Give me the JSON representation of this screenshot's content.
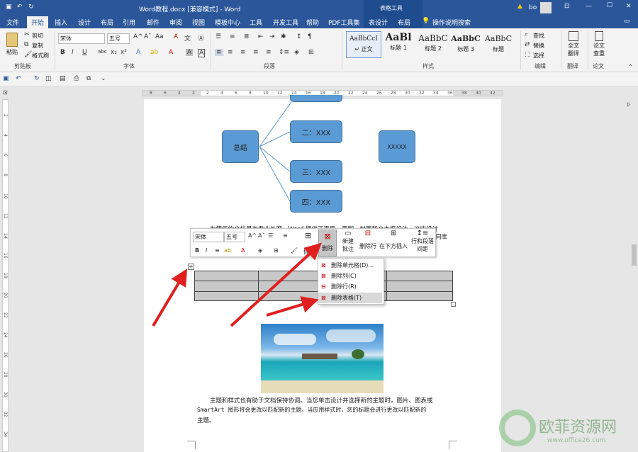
{
  "window": {
    "title": "Word教程.docx [兼容模式] - Word",
    "contextual_tools": "表格工具",
    "warning_icon": "warning-icon",
    "user": "bo",
    "accent_color": "#2b579a"
  },
  "tabs": [
    "文件",
    "开始",
    "插入",
    "设计",
    "布局",
    "引用",
    "邮件",
    "审阅",
    "视图",
    "模板中心",
    "工具",
    "开发工具",
    "帮助",
    "PDF工具集",
    "表设计",
    "布局",
    "操作说明搜索"
  ],
  "ribbon": {
    "clipboard": {
      "paste": "粘贴",
      "cut": "剪切",
      "copy": "复制",
      "format_painter": "格式刷",
      "group": "剪贴板"
    },
    "font": {
      "name": "宋体",
      "size": "五号",
      "group": "字体"
    },
    "paragraph": {
      "group": "段落"
    },
    "styles": {
      "items": [
        {
          "preview": "AaBbCcI",
          "name": "↵ 正文"
        },
        {
          "preview": "AaBl",
          "name": "标题 1"
        },
        {
          "preview": "AaBbC",
          "name": "标题 2"
        },
        {
          "preview": "AaBbC",
          "name": "标题 3"
        },
        {
          "preview": "AaBbC",
          "name": "标题"
        }
      ],
      "group": "样式"
    },
    "editing": {
      "find": "查找",
      "replace": "替换",
      "select": "选择",
      "group": "编辑"
    },
    "translate": {
      "label1": "全文",
      "label2": "翻译",
      "group": "翻译"
    },
    "paper": {
      "label1": "论文",
      "label2": "查重",
      "group": "论文"
    }
  },
  "diagram": {
    "root": "总结",
    "children": [
      "二：XXX",
      "三：XXX",
      "四：XXX"
    ],
    "side": "XXXXX"
  },
  "body_text_1": "为使您的文档具有专业外观，Word 提供了页眉、页脚、封面和文本框设计，这些设计",
  "body_text_1_tail": "同库",
  "mini_toolbar": {
    "font": "宋体",
    "size": "五号",
    "delete": "删除",
    "new_comment_1": "新建",
    "new_comment_2": "批注",
    "delete_row": "删除行",
    "insert_below": "在下方插入",
    "row_col_1": "行和段落",
    "row_col_2": "间距",
    "insert_label": "插"
  },
  "context_menu": [
    "删除单元格(D)...",
    "删除列(C)",
    "删除行(R)",
    "删除表格(T)"
  ],
  "body_text_2": [
    "主题和样式也有助于文档保持协调。当您单击设计并选择新的主题时，图片、图表或",
    "SmartArt 图形将会更改以匹配新的主题。当应用样式时，您的标题会进行更改以匹配新的",
    "主题。"
  ],
  "watermark": {
    "brand": "欧菲资源网",
    "url": "www.office26.com"
  },
  "ruler_numbers": [
    "8",
    "6",
    "4",
    "2",
    "2",
    "4",
    "6",
    "8",
    "10",
    "12",
    "14",
    "16",
    "18",
    "20",
    "22",
    "24",
    "26",
    "28",
    "30",
    "32",
    "34",
    "36",
    "38",
    "40",
    "42"
  ],
  "vruler_numbers": [
    "2",
    "4",
    "6",
    "8",
    "10",
    "12",
    "14",
    "16",
    "18",
    "20",
    "22",
    "24",
    "26",
    "28",
    "30",
    "32",
    "34"
  ]
}
